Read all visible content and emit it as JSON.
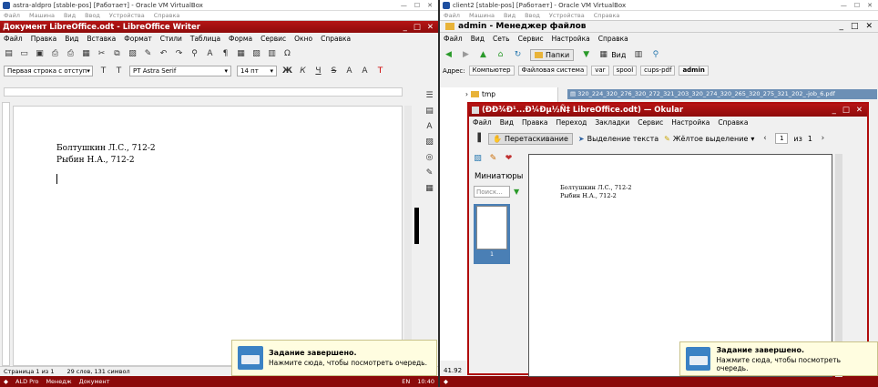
{
  "left_vm": {
    "vbox_title": "astra-aldpro [stable-pos] [Работает] - Oracle VM VirtualBox",
    "vbox_menu": [
      "Файл",
      "Машина",
      "Вид",
      "Ввод",
      "Устройства",
      "Справка"
    ],
    "window_title": "Документ LibreOffice.odt - LibreOffice Writer",
    "menu": [
      "Файл",
      "Правка",
      "Вид",
      "Вставка",
      "Формат",
      "Стили",
      "Таблица",
      "Форма",
      "Сервис",
      "Окно",
      "Справка"
    ],
    "para_style": "Первая строка с отступ",
    "font_name": "PT Astra Serif",
    "font_size": "14 пт",
    "doc_lines": [
      "Болтушкин Л.С., 712-2",
      "Рыбин Н.А., 712-2"
    ],
    "status": {
      "page": "Страница 1 из 1",
      "words": "29 слов, 131 символ",
      "style": "Первая стр"
    },
    "notification": {
      "title": "Задание завершено.",
      "body": "Нажмите сюда, чтобы посмотреть очередь."
    },
    "taskbar": [
      "ALD Pro",
      "Менедж",
      "Документ"
    ],
    "tray": {
      "lang": "EN",
      "time": "10:40"
    }
  },
  "right_vm": {
    "vbox_title": "client2 [stable-pos] [Работает] - Oracle VM VirtualBox",
    "vbox_menu": [
      "Файл",
      "Машина",
      "Вид",
      "Ввод",
      "Устройства",
      "Справка"
    ],
    "window_title": "admin - Менеджер файлов",
    "menu": [
      "Файл",
      "Вид",
      "Сеть",
      "Сервис",
      "Настройка",
      "Справка"
    ],
    "folders_btn": "Папки",
    "view_btn": "Вид",
    "address_label": "Адрес:",
    "crumbs": [
      "Компьютер",
      "Файловая система",
      "var",
      "spool",
      "cups-pdf",
      "admin"
    ],
    "tree_item": "tmp",
    "selected_file": "320_224_320_276_320_272_321_203_320_274_320_265_320_275_321_202_-job_6.pdf",
    "status_size": "41.92",
    "notification": {
      "title": "Задание завершено.",
      "body": "Нажмите сюда, чтобы посмотреть очередь."
    },
    "okular": {
      "title": "(ÐÐ¾Ð¹...Ð¼Ðµ½Ñ‡ LibreOffice.odt) — Okular",
      "menu": [
        "Файл",
        "Вид",
        "Правка",
        "Переход",
        "Закладки",
        "Сервис",
        "Настройка",
        "Справка"
      ],
      "drag_btn": "Перетаскивание",
      "select_text": "Выделение текста",
      "highlight": "Жёлтое выделение",
      "page_num": "1",
      "page_of": "из",
      "page_total": "1",
      "thumbs_label": "Миниатюры",
      "search_placeholder": "Поиск...",
      "thumb_num": "1",
      "doc_lines": [
        "Болтушкин Л.С., 712-2",
        "Рыбин Н.А., 712-2"
      ]
    }
  }
}
